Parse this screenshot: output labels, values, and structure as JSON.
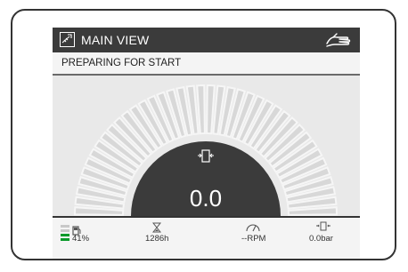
{
  "header": {
    "title": "MAIN VIEW",
    "view_icon": "main-view-icon",
    "hand_icon": "hand-icon"
  },
  "status": {
    "text": "PREPARING FOR START"
  },
  "gauge": {
    "icon": "pressure-icon",
    "value": "0.0",
    "level": 0,
    "colors": {
      "dark": "#3b3b3b",
      "segment": "#d8d8d8",
      "segment_stroke": "#f6f6f6"
    }
  },
  "bottom": {
    "fuel": {
      "icon": "fuel-icon",
      "value": "41%",
      "level": 0.41,
      "color": "#0a9a2a"
    },
    "hours": {
      "icon": "hourglass-icon",
      "value": "1286h"
    },
    "rpm": {
      "icon": "rpm-gauge-icon",
      "value": "--RPM"
    },
    "pressure": {
      "icon": "pressure-small-icon",
      "value": "0.0bar"
    }
  }
}
